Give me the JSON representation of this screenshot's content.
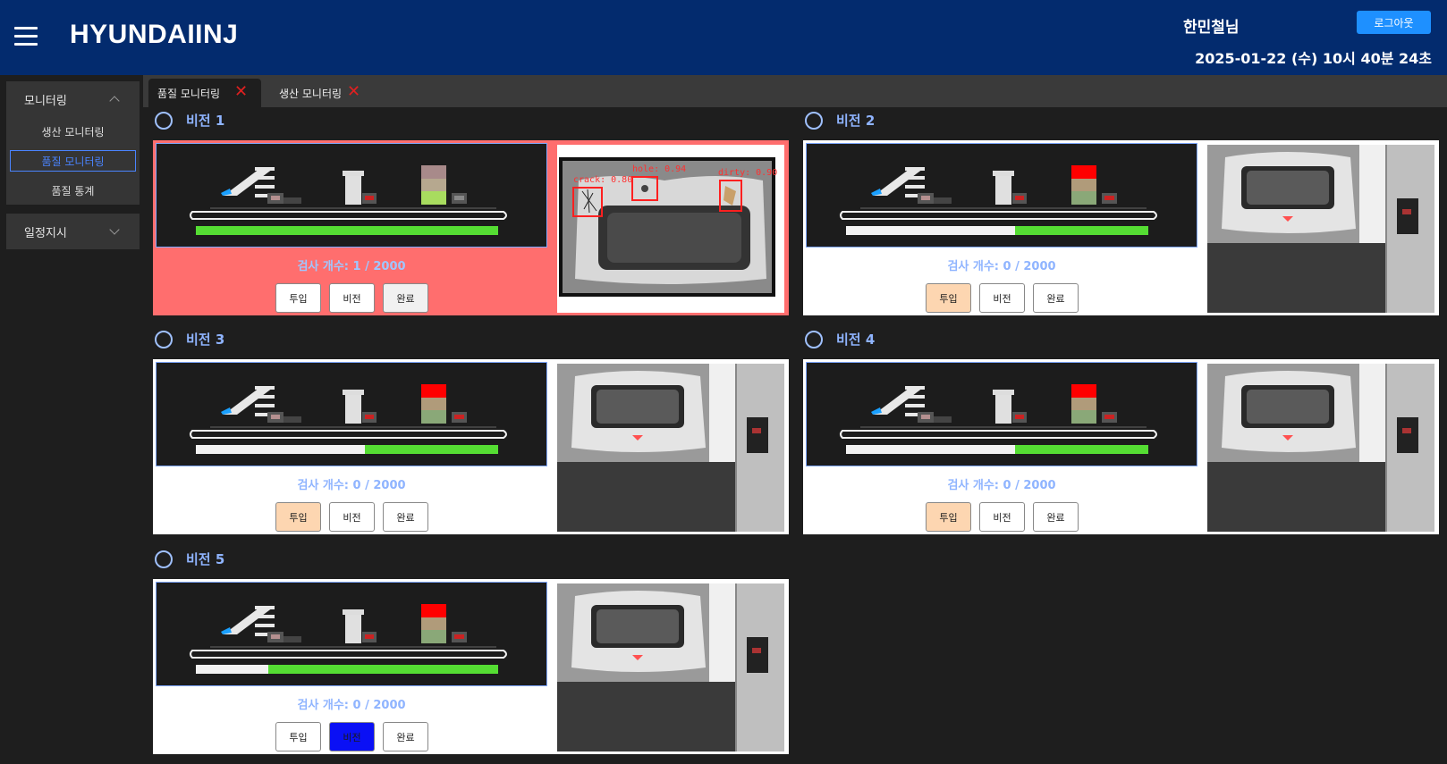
{
  "header": {
    "brand": "HYUNDAIINJ",
    "user": "한민철님",
    "logout_label": "로그아웃",
    "datetime": "2025-01-22 (수) 10시 40분 24초"
  },
  "sidebar": {
    "groups": [
      {
        "label": "모니터링",
        "expanded": true,
        "items": [
          {
            "label": "생산 모니터링",
            "active": false
          },
          {
            "label": "품질 모니터링",
            "active": true
          },
          {
            "label": "품질 통계",
            "active": false
          }
        ]
      },
      {
        "label": "일정지시",
        "expanded": false
      }
    ]
  },
  "tabs": [
    {
      "label": "품질 모니터링",
      "active": true
    },
    {
      "label": "생산 모니터링",
      "active": false
    }
  ],
  "stations": [
    {
      "name": "비전 1",
      "count_text": "검사 개수: 1 / 2000",
      "alert": true,
      "progress": 1.0,
      "stack": [
        "#a88a8a",
        "#b6a88f",
        "#a8dc5f"
      ],
      "buttons": [
        {
          "label": "투입",
          "state": "normal"
        },
        {
          "label": "비전",
          "state": "normal"
        },
        {
          "label": "완료",
          "state": "grey"
        }
      ],
      "detections": [
        "crack: 0.80",
        "hole: 0.94",
        "dirty: 0.90"
      ]
    },
    {
      "name": "비전 2",
      "count_text": "검사 개수: 0 / 2000",
      "alert": false,
      "progress": 0.44,
      "stack": [
        "#ff0000",
        "#b09b7a",
        "#8aa878"
      ],
      "buttons": [
        {
          "label": "투입",
          "state": "peach"
        },
        {
          "label": "비전",
          "state": "normal"
        },
        {
          "label": "완료",
          "state": "normal"
        }
      ],
      "detections": []
    },
    {
      "name": "비전 3",
      "count_text": "검사 개수: 0 / 2000",
      "alert": false,
      "progress": 0.44,
      "stack": [
        "#ff0000",
        "#b09b7a",
        "#8aa878"
      ],
      "buttons": [
        {
          "label": "투입",
          "state": "peach"
        },
        {
          "label": "비전",
          "state": "normal"
        },
        {
          "label": "완료",
          "state": "normal"
        }
      ],
      "detections": []
    },
    {
      "name": "비전 4",
      "count_text": "검사 개수: 0 / 2000",
      "alert": false,
      "progress": 0.44,
      "stack": [
        "#ff0000",
        "#b09b7a",
        "#8aa878"
      ],
      "buttons": [
        {
          "label": "투입",
          "state": "peach"
        },
        {
          "label": "비전",
          "state": "normal"
        },
        {
          "label": "완료",
          "state": "normal"
        }
      ],
      "detections": []
    },
    {
      "name": "비전 5",
      "count_text": "검사 개수: 0 / 2000",
      "alert": false,
      "progress": 0.76,
      "stack": [
        "#ff0000",
        "#b09b7a",
        "#8aa878"
      ],
      "buttons": [
        {
          "label": "투입",
          "state": "normal"
        },
        {
          "label": "비전",
          "state": "blue"
        },
        {
          "label": "완료",
          "state": "normal"
        }
      ],
      "detections": []
    }
  ]
}
